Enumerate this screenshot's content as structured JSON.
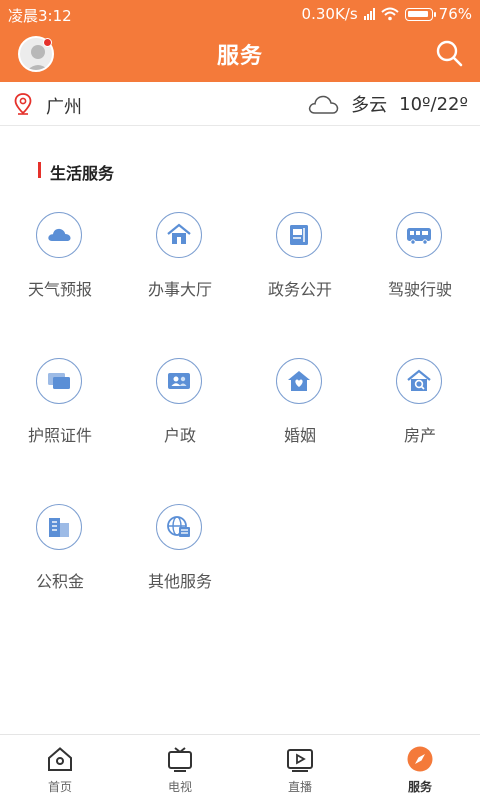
{
  "status_bar": {
    "time": "凌晨3:12",
    "network_speed": "0.30K/s",
    "battery": "76%"
  },
  "header": {
    "title": "服务",
    "avatar_icon": "user-avatar-icon",
    "search_icon": "search-icon"
  },
  "location": {
    "city": "广州",
    "weather_icon": "cloud-icon",
    "condition": "多云",
    "temperature": "10º/22º"
  },
  "section": {
    "title": "生活服务"
  },
  "services": [
    {
      "label": "天气预报",
      "icon": "cloud-icon"
    },
    {
      "label": "办事大厅",
      "icon": "house-icon"
    },
    {
      "label": "政务公开",
      "icon": "document-flag-icon"
    },
    {
      "label": "驾驶行驶",
      "icon": "bus-icon"
    },
    {
      "label": "护照证件",
      "icon": "cards-icon"
    },
    {
      "label": "户政",
      "icon": "id-card-icon"
    },
    {
      "label": "婚姻",
      "icon": "heart-house-icon"
    },
    {
      "label": "房产",
      "icon": "house-search-icon"
    },
    {
      "label": "公积金",
      "icon": "building-icon"
    },
    {
      "label": "其他服务",
      "icon": "globe-document-icon"
    }
  ],
  "bottom_nav": [
    {
      "label": "首页",
      "icon": "home-icon",
      "active": false
    },
    {
      "label": "电视",
      "icon": "tv-icon",
      "active": false
    },
    {
      "label": "直播",
      "icon": "live-video-icon",
      "active": false
    },
    {
      "label": "服务",
      "icon": "compass-icon",
      "active": true
    }
  ],
  "colors": {
    "brand": "#f47a3a",
    "accent_red": "#e5312b",
    "icon_blue": "#7d9fd1"
  }
}
